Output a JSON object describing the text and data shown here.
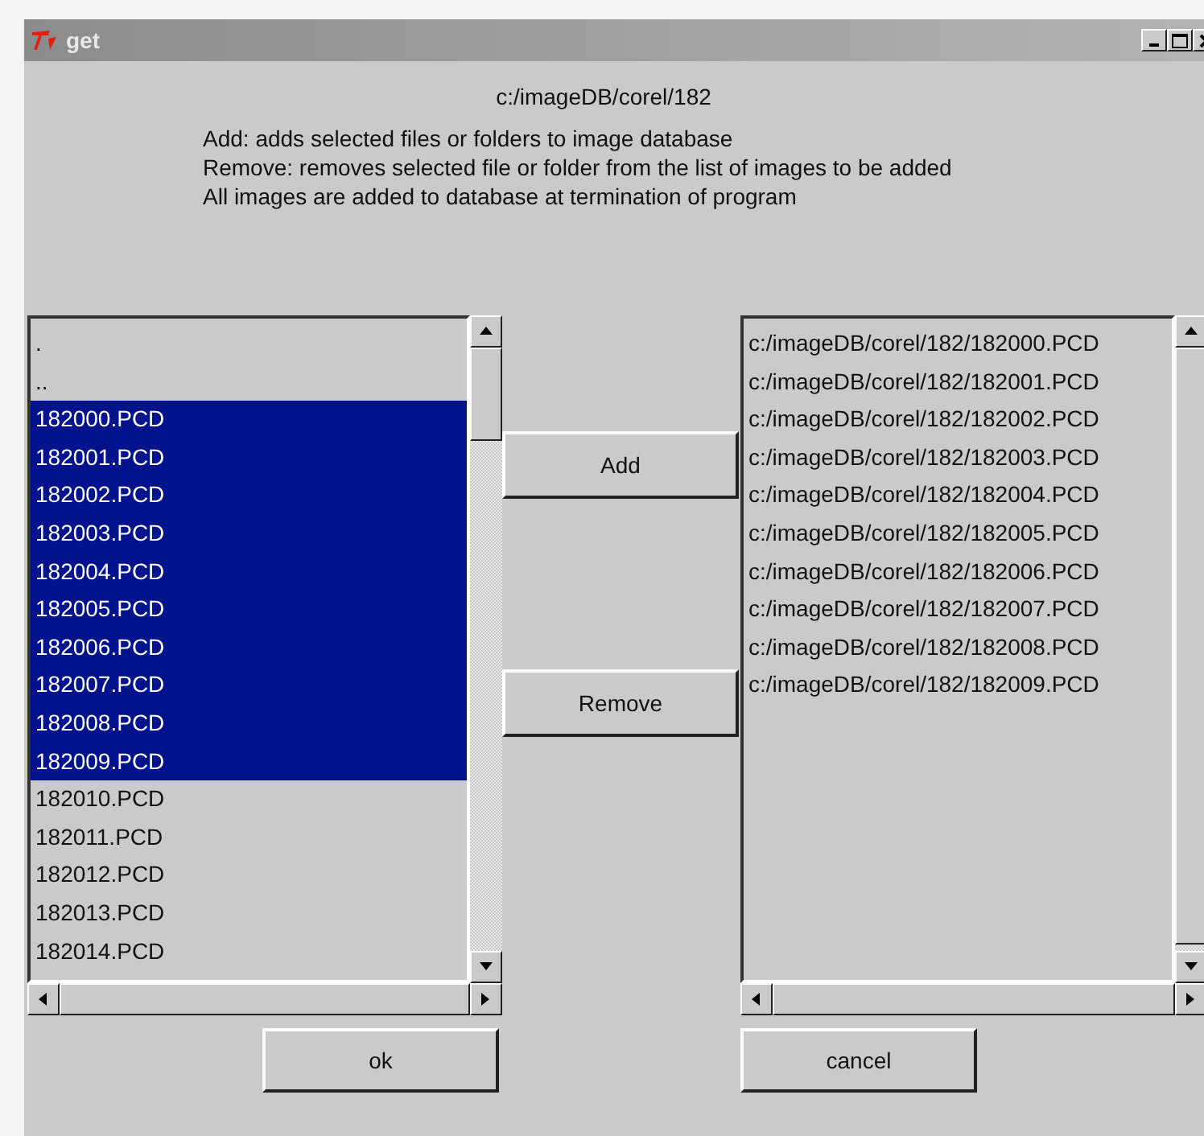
{
  "window": {
    "title": "get"
  },
  "path": "c:/imageDB/corel/182",
  "instructions": [
    "Add: adds selected files or folders to image database",
    "Remove: removes selected file or folder from the list of images to be added",
    "All images are added to database at termination of program"
  ],
  "source_list": [
    {
      "label": ".",
      "selected": false
    },
    {
      "label": "..",
      "selected": false
    },
    {
      "label": "182000.PCD",
      "selected": true
    },
    {
      "label": "182001.PCD",
      "selected": true
    },
    {
      "label": "182002.PCD",
      "selected": true
    },
    {
      "label": "182003.PCD",
      "selected": true
    },
    {
      "label": "182004.PCD",
      "selected": true
    },
    {
      "label": "182005.PCD",
      "selected": true
    },
    {
      "label": "182006.PCD",
      "selected": true
    },
    {
      "label": "182007.PCD",
      "selected": true
    },
    {
      "label": "182008.PCD",
      "selected": true
    },
    {
      "label": "182009.PCD",
      "selected": true
    },
    {
      "label": "182010.PCD",
      "selected": false
    },
    {
      "label": "182011.PCD",
      "selected": false
    },
    {
      "label": "182012.PCD",
      "selected": false
    },
    {
      "label": "182013.PCD",
      "selected": false
    },
    {
      "label": "182014.PCD",
      "selected": false
    }
  ],
  "middle_buttons": [
    "Add",
    "Remove"
  ],
  "added_list": [
    "c:/imageDB/corel/182/182000.PCD",
    "c:/imageDB/corel/182/182001.PCD",
    "c:/imageDB/corel/182/182002.PCD",
    "c:/imageDB/corel/182/182003.PCD",
    "c:/imageDB/corel/182/182004.PCD",
    "c:/imageDB/corel/182/182005.PCD",
    "c:/imageDB/corel/182/182006.PCD",
    "c:/imageDB/corel/182/182007.PCD",
    "c:/imageDB/corel/182/182008.PCD",
    "c:/imageDB/corel/182/182009.PCD"
  ],
  "bottom_buttons": [
    "ok",
    "cancel"
  ]
}
